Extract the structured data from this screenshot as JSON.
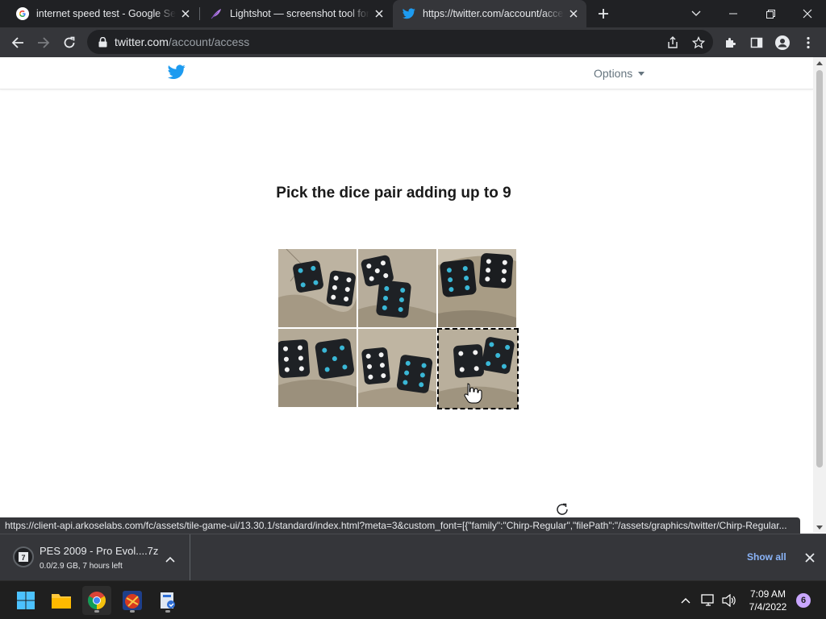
{
  "browser": {
    "tabs": [
      {
        "title": "internet speed test - Google Search",
        "favicon": "google-icon",
        "active": false
      },
      {
        "title": "Lightshot — screenshot tool for Mac & Win",
        "favicon": "lightshot-feather-icon",
        "active": false
      },
      {
        "title": "https://twitter.com/account/access",
        "favicon": "twitter-bird-icon",
        "active": true
      }
    ],
    "address": {
      "host": "twitter.com",
      "path": "/account/access"
    }
  },
  "page": {
    "options_label": "Options",
    "challenge_title": "Pick the dice pair adding up to 9",
    "tiles": [
      {
        "label": "dice-pair-1",
        "selected": false
      },
      {
        "label": "dice-pair-2",
        "selected": false
      },
      {
        "label": "dice-pair-3",
        "selected": false
      },
      {
        "label": "dice-pair-4",
        "selected": false
      },
      {
        "label": "dice-pair-5",
        "selected": false
      },
      {
        "label": "dice-pair-6",
        "selected": true
      }
    ]
  },
  "status_url": "https://client-api.arkoselabs.com/fc/assets/tile-game-ui/13.30.1/standard/index.html?meta=3&custom_font=[{\"family\":\"Chirp-Regular\",\"filePath\":\"/assets/graphics/twitter/Chirp-Regular...",
  "download": {
    "filename": "PES 2009 - Pro Evol....7z",
    "status": "0.0/2.9 GB, 7 hours left",
    "show_all_label": "Show all"
  },
  "taskbar": {
    "time": "7:09 AM",
    "date": "7/4/2022",
    "notification_count": "6"
  },
  "colors": {
    "twitter_blue": "#1d9bf0",
    "chrome_dark": "#202124",
    "toolbar": "#35363a",
    "link_blue": "#8ab4f8"
  }
}
